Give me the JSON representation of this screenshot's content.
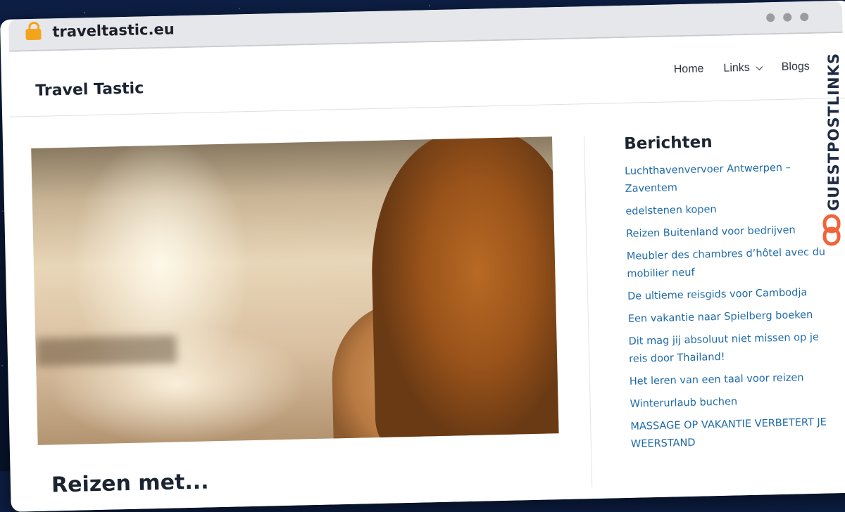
{
  "browser": {
    "url": "traveltastic.eu"
  },
  "site": {
    "title": "Travel Tastic",
    "nav": [
      {
        "label": "Home"
      },
      {
        "label": "Links"
      },
      {
        "label": "Blogs"
      }
    ]
  },
  "sidebar": {
    "heading": "Berichten",
    "posts": [
      "Luchthavenvervoer Antwerpen – Zaventem",
      "edelstenen kopen",
      "Reizen Buitenland voor bedrijven",
      "Meubler des chambres d’hôtel avec du mobilier neuf",
      "De ultieme reisgids voor Cambodja",
      "Een vakantie naar Spielberg boeken",
      "Dit mag jij absoluut niet missen op je reis door Thailand!",
      "Het leren van een taal voor reizen",
      "Winterurlaub buchen",
      "MASSAGE OP VAKANTIE VERBETERT JE WEERSTAND"
    ]
  },
  "main": {
    "post_title": "Reizen met..."
  },
  "badge": {
    "text": "GUESTPOSTLINKS"
  },
  "colors": {
    "link": "#1e6aa8",
    "badge_icon": "#f0643c",
    "lock": "#f2a51c"
  }
}
